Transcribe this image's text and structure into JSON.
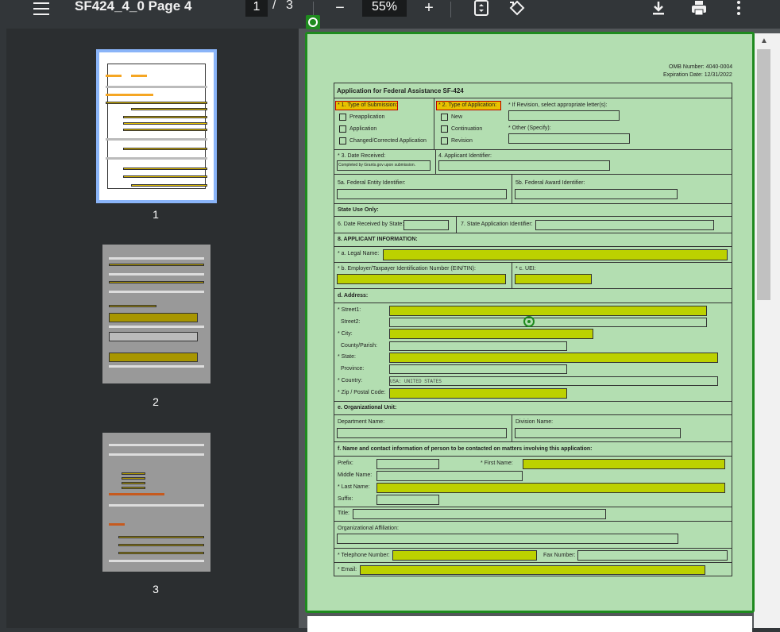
{
  "toolbar": {
    "title": "SF424_4_0 Page 4",
    "current_page": "1",
    "slash": "/",
    "total_pages": "3",
    "zoom": "55%",
    "zoom_out_symbol": "−",
    "zoom_in_symbol": "+",
    "download_symbol": "⤓",
    "print_symbol": "🖶",
    "more_symbol": "⋮",
    "fit_symbol": "⇕",
    "rotate_symbol": "⟲"
  },
  "sidebar": {
    "thumbnails": [
      {
        "number": "1"
      },
      {
        "number": "2"
      },
      {
        "number": "3"
      }
    ]
  },
  "form": {
    "omb_number": "OMB Number: 4040-0004",
    "expiration": "Expiration Date: 12/31/2022",
    "title": "Application for Federal Assistance SF-424",
    "type_submission": "* 1. Type of Submission:",
    "submission_options": [
      "Preapplication",
      "Application",
      "Changed/Corrected Application"
    ],
    "type_application": "* 2. Type of Application:",
    "application_options": [
      "New",
      "Continuation",
      "Revision"
    ],
    "revision_letter": "* If Revision, select appropriate letter(s):",
    "other_specify": "* Other (Specify):",
    "date_received": "* 3. Date Received:",
    "date_received_value": "Completed by Grants.gov upon submission.",
    "applicant_identifier": "4. Applicant Identifier:",
    "federal_entity": "5a. Federal Entity Identifier:",
    "federal_award": "5b. Federal Award Identifier:",
    "state_use": "State Use Only:",
    "date_received_state": "6. Date Received by State:",
    "state_app_id": "7. State Application Identifier:",
    "applicant_info": "8. APPLICANT INFORMATION:",
    "legal_name": "* a. Legal Name:",
    "ein": "* b. Employer/Taxpayer Identification Number (EIN/TIN):",
    "uei": "* c. UEI:",
    "address": "d. Address:",
    "street1": "* Street1:",
    "street2": "Street2:",
    "city": "* City:",
    "county": "County/Parish:",
    "state": "* State:",
    "province": "Province:",
    "country": "* Country:",
    "country_value": "USA: UNITED STATES",
    "zip": "* Zip / Postal Code:",
    "org_unit": "e. Organizational Unit:",
    "dept_name": "Department Name:",
    "division_name": "Division Name:",
    "contact_info": "f. Name and contact information of person to be contacted on matters involving this application:",
    "prefix": "Prefix:",
    "first_name": "* First Name:",
    "middle_name": "Middle Name:",
    "last_name": "* Last Name:",
    "suffix": "Suffix:",
    "title_label": "Title:",
    "org_affiliation": "Organizational Affiliation:",
    "telephone": "* Telephone Number:",
    "fax": "Fax Number:",
    "email": "* Email:"
  },
  "colors": {
    "page_bg": "#b3deb1",
    "page_border": "#1e8a1e",
    "required_field": "#bcd100",
    "toolbar": "#323639"
  },
  "icons": [
    "menu-icon",
    "zoom-out-icon",
    "zoom-in-icon",
    "fit-page-icon",
    "rotate-icon",
    "download-icon",
    "print-icon",
    "more-icon",
    "anchor-icon",
    "cursor-target-icon"
  ]
}
